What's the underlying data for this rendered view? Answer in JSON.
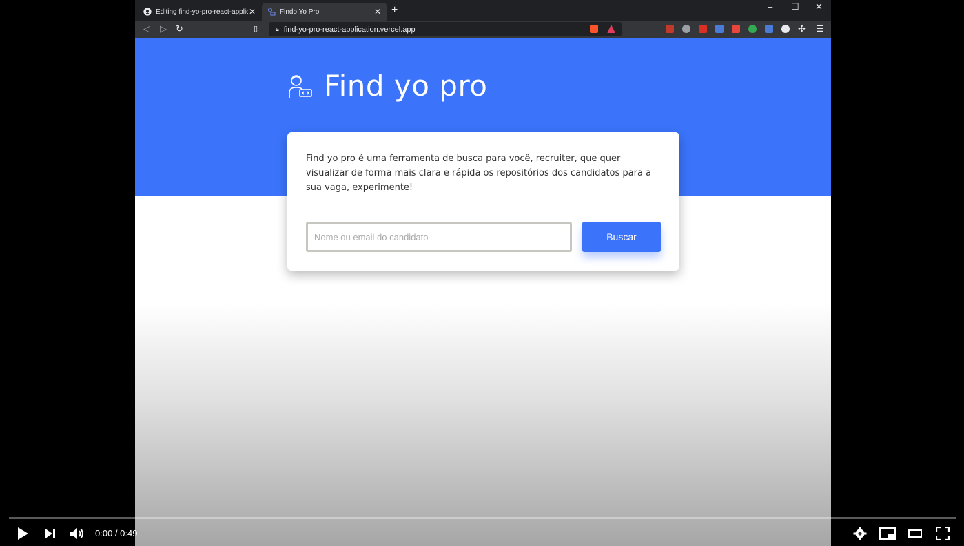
{
  "browser": {
    "tabs": [
      {
        "title": "Editing find-yo-pro-react-applicati",
        "icon": "github-icon",
        "active": false
      },
      {
        "title": "Findo Yo Pro",
        "icon": "site-favicon",
        "active": true
      }
    ],
    "new_tab": "+",
    "url": "find-yo-pro-react-application.vercel.app",
    "window_controls": {
      "minimize": "–",
      "maximize": "☐",
      "close": "✕"
    }
  },
  "app": {
    "brand_name": "Find yo pro",
    "description": "Find yo pro é uma ferramenta de busca para você, recruiter, que quer visualizar de forma mais clara e rápida os repositórios dos candidatos para a sua vaga, experimente!",
    "search_placeholder": "Nome ou email do candidato",
    "search_value": "",
    "search_button": "Buscar",
    "colors": {
      "primary": "#3b74fb",
      "card": "#ffffff"
    }
  },
  "player": {
    "time": "0:00 / 0:49",
    "progress": 0
  }
}
